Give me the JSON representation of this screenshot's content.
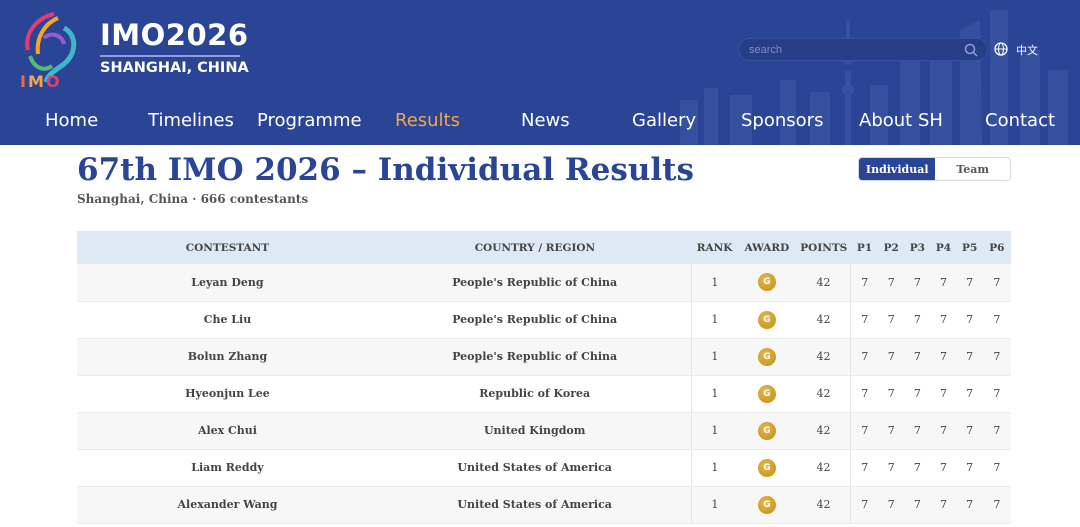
{
  "header": {
    "logo_title": "IMO2026",
    "logo_subtitle": "SHANGHAI, CHINA",
    "search_placeholder": "search",
    "language": "中文",
    "colors": {
      "primary": "#2b4596",
      "active_nav": "#f0a64a"
    }
  },
  "nav": [
    {
      "label": "Home",
      "active": false
    },
    {
      "label": "Timelines",
      "active": false
    },
    {
      "label": "Programme",
      "active": false
    },
    {
      "label": "Results",
      "active": true
    },
    {
      "label": "News",
      "active": false
    },
    {
      "label": "Gallery",
      "active": false
    },
    {
      "label": "Sponsors",
      "active": false
    },
    {
      "label": "About SH",
      "active": false
    },
    {
      "label": "Contact",
      "active": false
    }
  ],
  "main": {
    "title": "67th IMO 2026 – Individual Results",
    "subtitle": "Shanghai, China · 666 contestants",
    "toggle": {
      "individual": "Individual",
      "team": "Team",
      "selected": "individual"
    }
  },
  "table": {
    "headers": [
      "Contestant",
      "Country / Region",
      "Rank",
      "Award",
      "Points",
      "P1",
      "P2",
      "P3",
      "P4",
      "P5",
      "P6"
    ],
    "rows": [
      {
        "name": "Leyan Deng",
        "country": "People's Republic of China",
        "rank": "1",
        "award": "G",
        "points": "42",
        "scores": [
          "7",
          "7",
          "7",
          "7",
          "7",
          "7"
        ]
      },
      {
        "name": "Che Liu",
        "country": "People's Republic of China",
        "rank": "1",
        "award": "G",
        "points": "42",
        "scores": [
          "7",
          "7",
          "7",
          "7",
          "7",
          "7"
        ]
      },
      {
        "name": "Bolun Zhang",
        "country": "People's Republic of China",
        "rank": "1",
        "award": "G",
        "points": "42",
        "scores": [
          "7",
          "7",
          "7",
          "7",
          "7",
          "7"
        ]
      },
      {
        "name": "Hyeonjun Lee",
        "country": "Republic of Korea",
        "rank": "1",
        "award": "G",
        "points": "42",
        "scores": [
          "7",
          "7",
          "7",
          "7",
          "7",
          "7"
        ]
      },
      {
        "name": "Alex Chui",
        "country": "United Kingdom",
        "rank": "1",
        "award": "G",
        "points": "42",
        "scores": [
          "7",
          "7",
          "7",
          "7",
          "7",
          "7"
        ]
      },
      {
        "name": "Liam Reddy",
        "country": "United States of America",
        "rank": "1",
        "award": "G",
        "points": "42",
        "scores": [
          "7",
          "7",
          "7",
          "7",
          "7",
          "7"
        ]
      },
      {
        "name": "Alexander Wang",
        "country": "United States of America",
        "rank": "1",
        "award": "G",
        "points": "42",
        "scores": [
          "7",
          "7",
          "7",
          "7",
          "7",
          "7"
        ]
      }
    ]
  }
}
